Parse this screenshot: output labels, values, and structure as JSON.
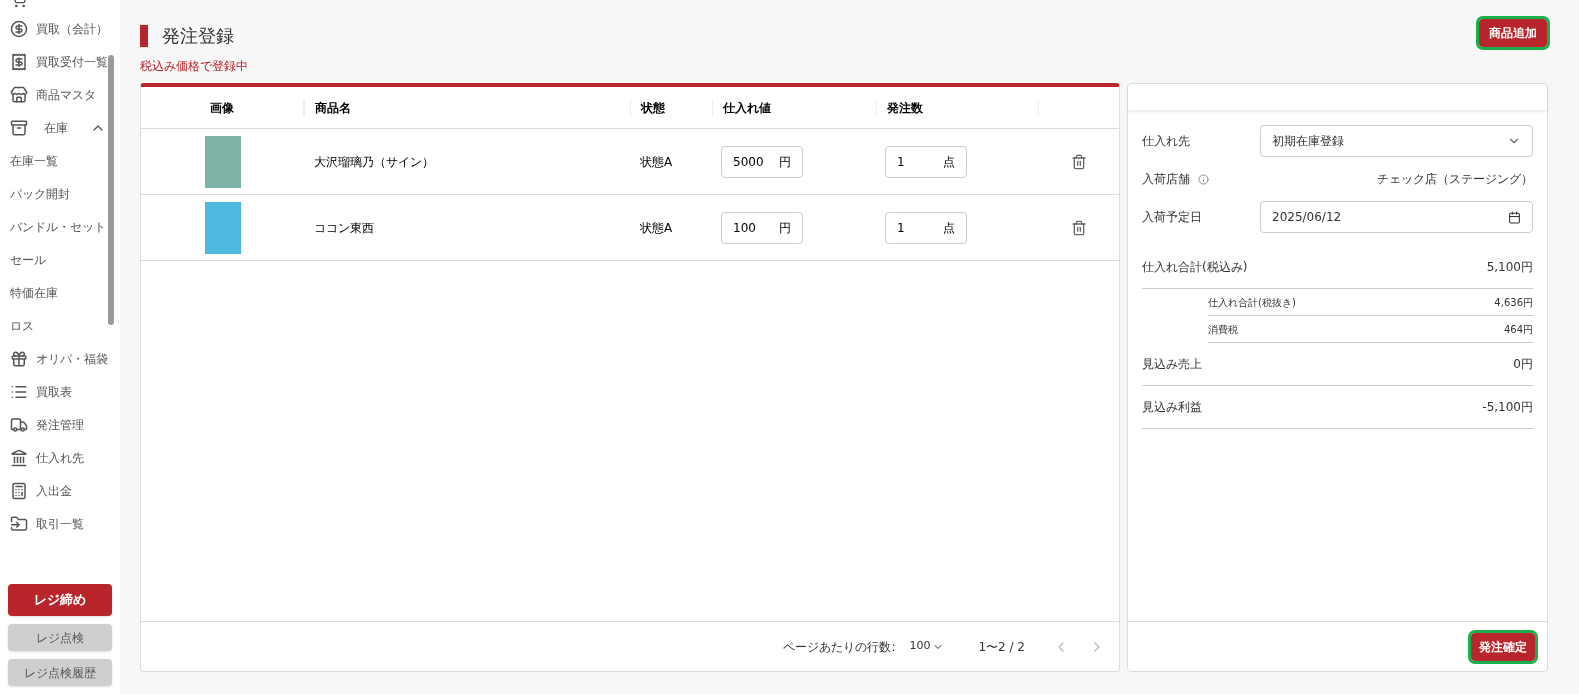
{
  "sidebar": {
    "items": [
      {
        "kind": "icon",
        "label": "買取（会計）"
      },
      {
        "kind": "icon",
        "label": "買取受付一覧"
      },
      {
        "kind": "icon",
        "label": "商品マスタ"
      },
      {
        "kind": "group",
        "label": "在庫",
        "expanded": true
      },
      {
        "kind": "sub",
        "label": "在庫一覧"
      },
      {
        "kind": "sub",
        "label": "パック開封"
      },
      {
        "kind": "sub",
        "label": "バンドル・セット"
      },
      {
        "kind": "sub",
        "label": "セール"
      },
      {
        "kind": "sub",
        "label": "特価在庫"
      },
      {
        "kind": "sub",
        "label": "ロス"
      },
      {
        "kind": "icon",
        "label": "オリパ・福袋"
      },
      {
        "kind": "icon",
        "label": "買取表"
      },
      {
        "kind": "icon",
        "label": "発注管理"
      },
      {
        "kind": "icon",
        "label": "仕入れ先"
      },
      {
        "kind": "icon",
        "label": "入出金"
      },
      {
        "kind": "icon",
        "label": "取引一覧"
      }
    ],
    "buttons": [
      {
        "label": "レジ締め",
        "kind": "primary"
      },
      {
        "label": "レジ点検",
        "kind": "secondary"
      },
      {
        "label": "レジ点検履歴",
        "kind": "secondary"
      }
    ]
  },
  "page": {
    "title": "発注登録",
    "notice": "税込み価格で登録中",
    "add_button": "商品追加"
  },
  "table": {
    "columns": [
      "画像",
      "商品名",
      "状態",
      "仕入れ値",
      "発注数"
    ],
    "rows": [
      {
        "name": "大沢瑠璃乃（サイン）",
        "condition": "状態A",
        "price": "5000",
        "price_unit": "円",
        "qty": "1",
        "qty_unit": "点"
      },
      {
        "name": "ココン東西",
        "condition": "状態A",
        "price": "100",
        "price_unit": "円",
        "qty": "1",
        "qty_unit": "点"
      }
    ],
    "footer": {
      "rows_per_page_label": "ページあたりの行数:",
      "rows_per_page": "100",
      "range": "1〜2 / 2"
    }
  },
  "summary": {
    "supplier_label": "仕入れ先",
    "supplier": "初期在庫登録",
    "store_label": "入荷店舗",
    "store": "チェック店（ステージング）",
    "date_label": "入荷予定日",
    "date": "2025/06/12",
    "totals": [
      {
        "kind": "main",
        "label": "仕入れ合計(税込み)",
        "value": "5,100円"
      },
      {
        "kind": "sub",
        "label": "仕入れ合計(税抜き)",
        "value": "4,636円"
      },
      {
        "kind": "sub",
        "label": "消費税",
        "value": "464円"
      },
      {
        "kind": "main",
        "label": "見込み売上",
        "value": "0円"
      },
      {
        "kind": "main",
        "label": "見込み利益",
        "value": "-5,100円"
      }
    ],
    "confirm_button": "発注確定"
  }
}
